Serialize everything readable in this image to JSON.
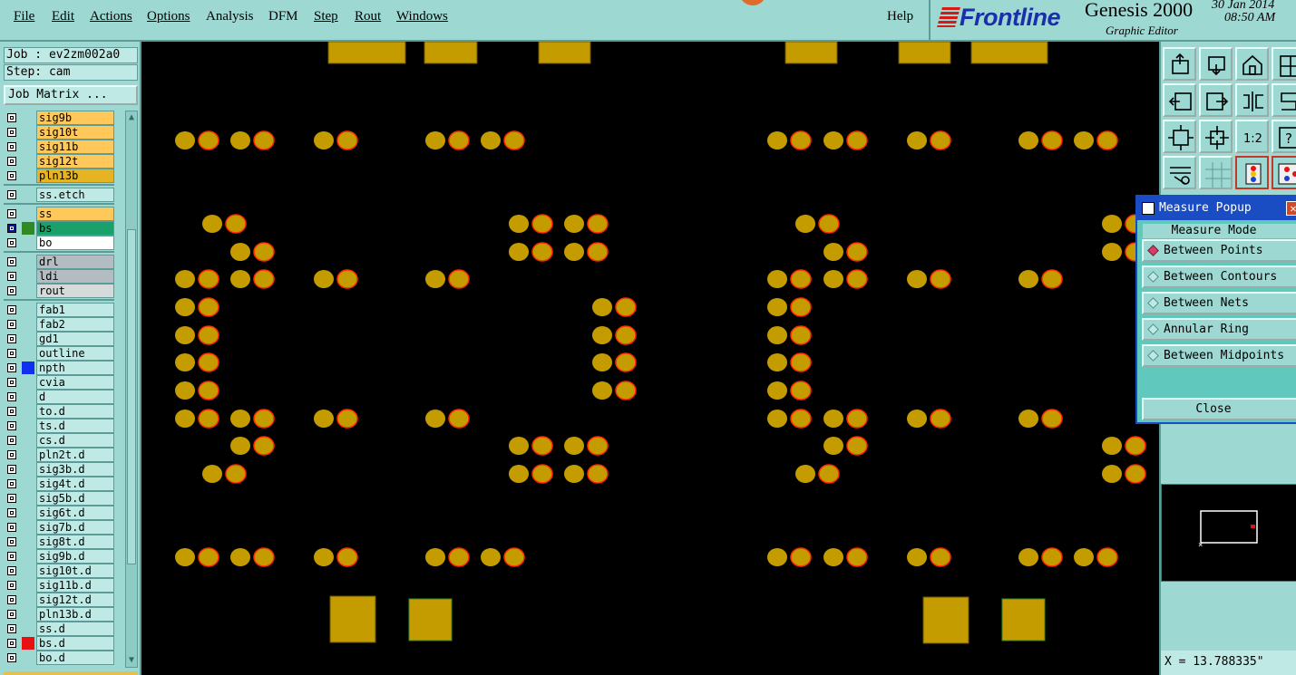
{
  "menu": {
    "items": [
      {
        "label": "File",
        "key": "file"
      },
      {
        "label": "Edit",
        "key": "edit"
      },
      {
        "label": "Actions",
        "key": "actions"
      },
      {
        "label": "Options",
        "key": "options"
      },
      {
        "label": "Analysis",
        "key": "analysis"
      },
      {
        "label": "DFM",
        "key": "dfm"
      },
      {
        "label": "Step",
        "key": "step"
      },
      {
        "label": "Rout",
        "key": "rout"
      },
      {
        "label": "Windows",
        "key": "windows"
      }
    ],
    "help": "Help"
  },
  "brand": {
    "logo": "Frontline",
    "product": "Genesis 2000",
    "subtitle": "Graphic Editor",
    "date": "30 Jan 2014",
    "time": "08:50 AM"
  },
  "job": {
    "job_line": "Job : ev2zm002a0",
    "step_line": "Step: cam",
    "matrix_button": "Job Matrix ..."
  },
  "layers": [
    {
      "name": "sig9b",
      "bg": "#ffc85a",
      "group": 1
    },
    {
      "name": "sig10t",
      "bg": "#ffc85a",
      "group": 1
    },
    {
      "name": "sig11b",
      "bg": "#ffc85a",
      "group": 1
    },
    {
      "name": "sig12t",
      "bg": "#ffc85a",
      "group": 1
    },
    {
      "name": "pln13b",
      "bg": "#e6b422",
      "group": 1
    },
    {
      "name": "ss.etch",
      "bg": "#bfe9e4",
      "group": 2
    },
    {
      "name": "ss",
      "bg": "#ffc85a",
      "group": 3
    },
    {
      "name": "bs",
      "bg": "#1aa06a",
      "group": 3,
      "swatch": "#2f8a24",
      "check_bg": "#0a1a8a"
    },
    {
      "name": "bo",
      "bg": "#ffffff",
      "group": 3
    },
    {
      "name": "drl",
      "bg": "#b3bcc0",
      "group": 4
    },
    {
      "name": "ldi",
      "bg": "#b3bcc0",
      "group": 4
    },
    {
      "name": "rout",
      "bg": "#d6dadb",
      "group": 4
    },
    {
      "name": "fab1",
      "bg": "#bfe9e4",
      "group": 5
    },
    {
      "name": "fab2",
      "bg": "#bfe9e4",
      "group": 5
    },
    {
      "name": "gd1",
      "bg": "#bfe9e4",
      "group": 5
    },
    {
      "name": "outline",
      "bg": "#bfe9e4",
      "group": 5
    },
    {
      "name": "npth",
      "bg": "#bfe9e4",
      "group": 5,
      "swatch": "#1030f0"
    },
    {
      "name": "cvia",
      "bg": "#bfe9e4",
      "group": 5
    },
    {
      "name": "d",
      "bg": "#bfe9e4",
      "group": 5
    },
    {
      "name": "to.d",
      "bg": "#bfe9e4",
      "group": 5
    },
    {
      "name": "ts.d",
      "bg": "#bfe9e4",
      "group": 5
    },
    {
      "name": "cs.d",
      "bg": "#bfe9e4",
      "group": 5
    },
    {
      "name": "pln2t.d",
      "bg": "#bfe9e4",
      "group": 5
    },
    {
      "name": "sig3b.d",
      "bg": "#bfe9e4",
      "group": 5
    },
    {
      "name": "sig4t.d",
      "bg": "#bfe9e4",
      "group": 5
    },
    {
      "name": "sig5b.d",
      "bg": "#bfe9e4",
      "group": 5
    },
    {
      "name": "sig6t.d",
      "bg": "#bfe9e4",
      "group": 5
    },
    {
      "name": "sig7b.d",
      "bg": "#bfe9e4",
      "group": 5
    },
    {
      "name": "sig8t.d",
      "bg": "#bfe9e4",
      "group": 5
    },
    {
      "name": "sig9b.d",
      "bg": "#bfe9e4",
      "group": 5
    },
    {
      "name": "sig10t.d",
      "bg": "#bfe9e4",
      "group": 5
    },
    {
      "name": "sig11b.d",
      "bg": "#bfe9e4",
      "group": 5
    },
    {
      "name": "sig12t.d",
      "bg": "#bfe9e4",
      "group": 5
    },
    {
      "name": "pln13b.d",
      "bg": "#bfe9e4",
      "group": 5
    },
    {
      "name": "ss.d",
      "bg": "#bfe9e4",
      "group": 5
    },
    {
      "name": "bs.d",
      "bg": "#bfe9e4",
      "group": 5,
      "swatch": "#e81010"
    },
    {
      "name": "bo.d",
      "bg": "#bfe9e4",
      "group": 5
    }
  ],
  "popup": {
    "title": "Measure Popup",
    "mode_label": "Measure Mode",
    "options": [
      {
        "label": "Between Points",
        "selected": true
      },
      {
        "label": "Between Contours",
        "selected": false
      },
      {
        "label": "Between Nets",
        "selected": false
      },
      {
        "label": "Annular Ring",
        "selected": false
      },
      {
        "label": "Between Midpoints",
        "selected": false
      }
    ],
    "close_label": "Close"
  },
  "status": {
    "x_readout": "X = 13.788335\""
  },
  "colors": {
    "pad": "#c49c00",
    "pad_outline": "#ff2a00",
    "panel": "#9ed8d2",
    "popup_title": "#1a4cc4"
  },
  "toolbar": {
    "buttons": [
      "zoom-home-icon",
      "zoom-window-icon",
      "home-icon",
      "grid-icon",
      "pan-left-icon",
      "pan-right-icon",
      "reflect-icon",
      "step-repeat-icon",
      "fit-icon",
      "center-icon",
      "scale-ratio-icon",
      "help-query-icon",
      "measure-icon",
      "snap-grid-icon",
      "layer-colors-icon",
      "layer-colors-alt-icon"
    ],
    "scale_ratio_label": "1:2"
  }
}
